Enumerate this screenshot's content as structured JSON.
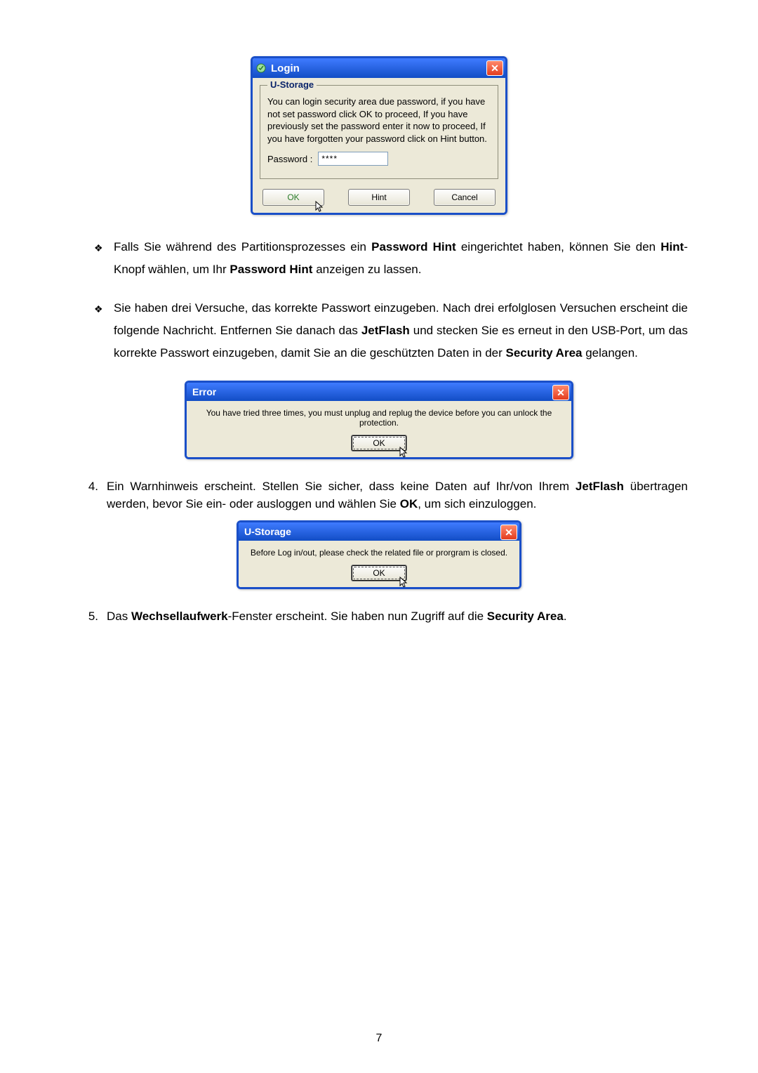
{
  "login": {
    "title": "Login",
    "group_title": "U-Storage",
    "body_text": "You can login security area due password, if you have not set password click OK to proceed, If you have previously set the password enter it now to proceed, If you have forgotten your password click on Hint button.",
    "password_label": "Password :",
    "password_value": "****",
    "ok": "OK",
    "hint": "Hint",
    "cancel": "Cancel"
  },
  "bullets": {
    "b1_pre": "Falls Sie während des Partitionsprozesses ein ",
    "b1_bold1": "Password Hint",
    "b1_mid1": " eingerichtet haben, können Sie den ",
    "b1_bold2": "Hint",
    "b1_mid2": "-Knopf wählen, um Ihr ",
    "b1_bold3": "Password Hint",
    "b1_end": " anzeigen zu lassen.",
    "b2_pre": "Sie haben drei Versuche, das korrekte Passwort einzugeben. Nach drei erfolglosen Versuchen erscheint die folgende Nachricht. Entfernen Sie danach das ",
    "b2_bold1": "JetFlash",
    "b2_mid1": " und stecken Sie es erneut in den USB-Port, um das korrekte Passwort einzugeben, damit Sie an die geschützten Daten in der ",
    "b2_bold2": "Security Area",
    "b2_end": " gelangen."
  },
  "error": {
    "title": "Error",
    "text": "You have tried three times, you must unplug and replug the device before you can unlock the protection.",
    "ok": "OK"
  },
  "item4": {
    "num": "4.",
    "pre": "Ein Warnhinweis erscheint. Stellen Sie sicher, dass keine Daten auf Ihr/von Ihrem ",
    "bold1": "JetFlash",
    "mid": " übertragen werden, bevor Sie ein- oder ausloggen und wählen Sie ",
    "bold2": "OK",
    "end": ", um sich einzuloggen."
  },
  "ustorage": {
    "title": "U-Storage",
    "text": "Before Log in/out, please check the related file or prorgram is closed.",
    "ok": "OK"
  },
  "item5": {
    "num": "5.",
    "pre": "Das ",
    "bold1": "Wechsellaufwerk",
    "mid": "-Fenster erscheint. Sie haben nun Zugriff auf die ",
    "bold2": "Security Area",
    "end": "."
  },
  "page_number": "7"
}
